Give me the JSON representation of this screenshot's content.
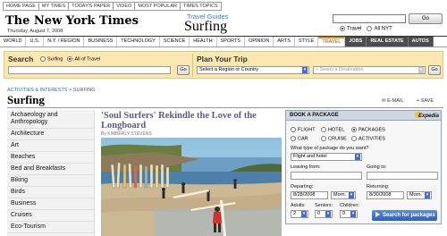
{
  "top_nav": [
    "HOME PAGE",
    "MY TIMES",
    "TODAY'S PAPER",
    "VIDEO",
    "MOST POPULAR",
    "TIMES TOPICS"
  ],
  "masthead": {
    "logo": "The New York Times",
    "date": "Thursday, August 7, 2008",
    "guides_label": "Travel Guides",
    "section": "Surfing",
    "search_button": "Go",
    "scope_options": [
      "Travel",
      "All NYT"
    ]
  },
  "section_nav": [
    "WORLD",
    "U.S.",
    "N.Y. / REGION",
    "BUSINESS",
    "TECHNOLOGY",
    "SCIENCE",
    "HEALTH",
    "SPORTS",
    "OPINION",
    "ARTS",
    "STYLE",
    "TRAVEL",
    "JOBS",
    "REAL ESTATE",
    "AUTOS"
  ],
  "search_bar": {
    "label": "Search",
    "options": [
      "Surfing",
      "All of Travel"
    ],
    "go": "Go",
    "plan_label": "Plan Your Trip",
    "region_select": "Select a Region or Country",
    "destination_select": "« Select a Destination"
  },
  "page": {
    "breadcrumb_link": "ACTIVITIES & INTERESTS",
    "breadcrumb_sep": " > ",
    "breadcrumb_current": "SURFING",
    "heading": "Surfing",
    "email": "E-MAIL",
    "save": "SAVE"
  },
  "sidebar": [
    "Archaeology and Anthropology",
    "Architecture",
    "Art",
    "Beaches",
    "Bed and Breakfasts",
    "Biking",
    "Birds",
    "Business",
    "Cruises",
    "Eco-Tourism"
  ],
  "article": {
    "headline": "'Soul Surfers' Rekindle the Love of the Longboard",
    "byline": "By KIMBERLY STEVENS"
  },
  "booking": {
    "title": "BOOK A PACKAGE",
    "brand": "Expedia",
    "options_row1": [
      "FLIGHT",
      "HOTEL",
      "PACKAGES"
    ],
    "options_row2": [
      "CAR",
      "CRUISE",
      "ACTIVITIES"
    ],
    "question": "What type of package do you want?",
    "package_type": "Flight and hotel",
    "leaving_label": "Leaving from:",
    "going_label": "Going to:",
    "departing_label": "Departing:",
    "departing_date": "8/28/2008",
    "returning_label": "Returning:",
    "returning_date": "8/30/2008",
    "time_label": "Morn.",
    "adults_label": "Adults:",
    "adults_value": "2",
    "seniors_label": "Seniors:",
    "seniors_value": "0",
    "children_label": "Children:",
    "children_value": "0",
    "search_button": "Search for packages"
  }
}
